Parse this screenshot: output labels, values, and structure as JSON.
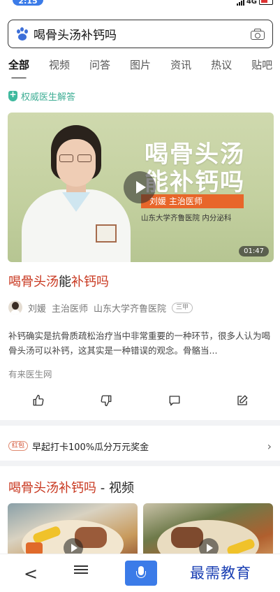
{
  "status_bar": {
    "time": "2:15",
    "network": "4G"
  },
  "search": {
    "query": "喝骨头汤补钙吗"
  },
  "tabs": [
    {
      "label": "全部",
      "active": true
    },
    {
      "label": "视频"
    },
    {
      "label": "问答"
    },
    {
      "label": "图片"
    },
    {
      "label": "资讯"
    },
    {
      "label": "热议"
    },
    {
      "label": "贴吧"
    }
  ],
  "authority_label": "权威医生解答",
  "video": {
    "title_line1": "喝骨头汤",
    "title_line2": "能补钙吗",
    "doctor_line": "刘媛    主治医师",
    "hospital_line": "山东大学齐鲁医院  内分泌科",
    "duration": "01:47"
  },
  "result": {
    "title_part1": "喝骨头汤",
    "title_part2": "能",
    "title_part3": "补钙吗",
    "author_name": "刘媛",
    "author_title": "主治医师",
    "author_hospital": "山东大学齐鲁医院",
    "hospital_grade": "三甲",
    "snippet": "补钙确实是抗骨质疏松治疗当中非常重要的一种环节，很多人认为喝骨头汤可以补钙，这其实是一种错误的观念。骨骼当...",
    "source": "有来医生网"
  },
  "promo": {
    "tag": "红包",
    "text": "早起打卡100%瓜分万元奖金"
  },
  "video_section": {
    "title_highlight": "喝骨头汤补钙吗",
    "title_suffix": " - 视频"
  },
  "watermark": "最需教育",
  "colors": {
    "highlight": "#c8371f",
    "accent_blue": "#3b7be8",
    "authority_green": "#3fae95"
  }
}
